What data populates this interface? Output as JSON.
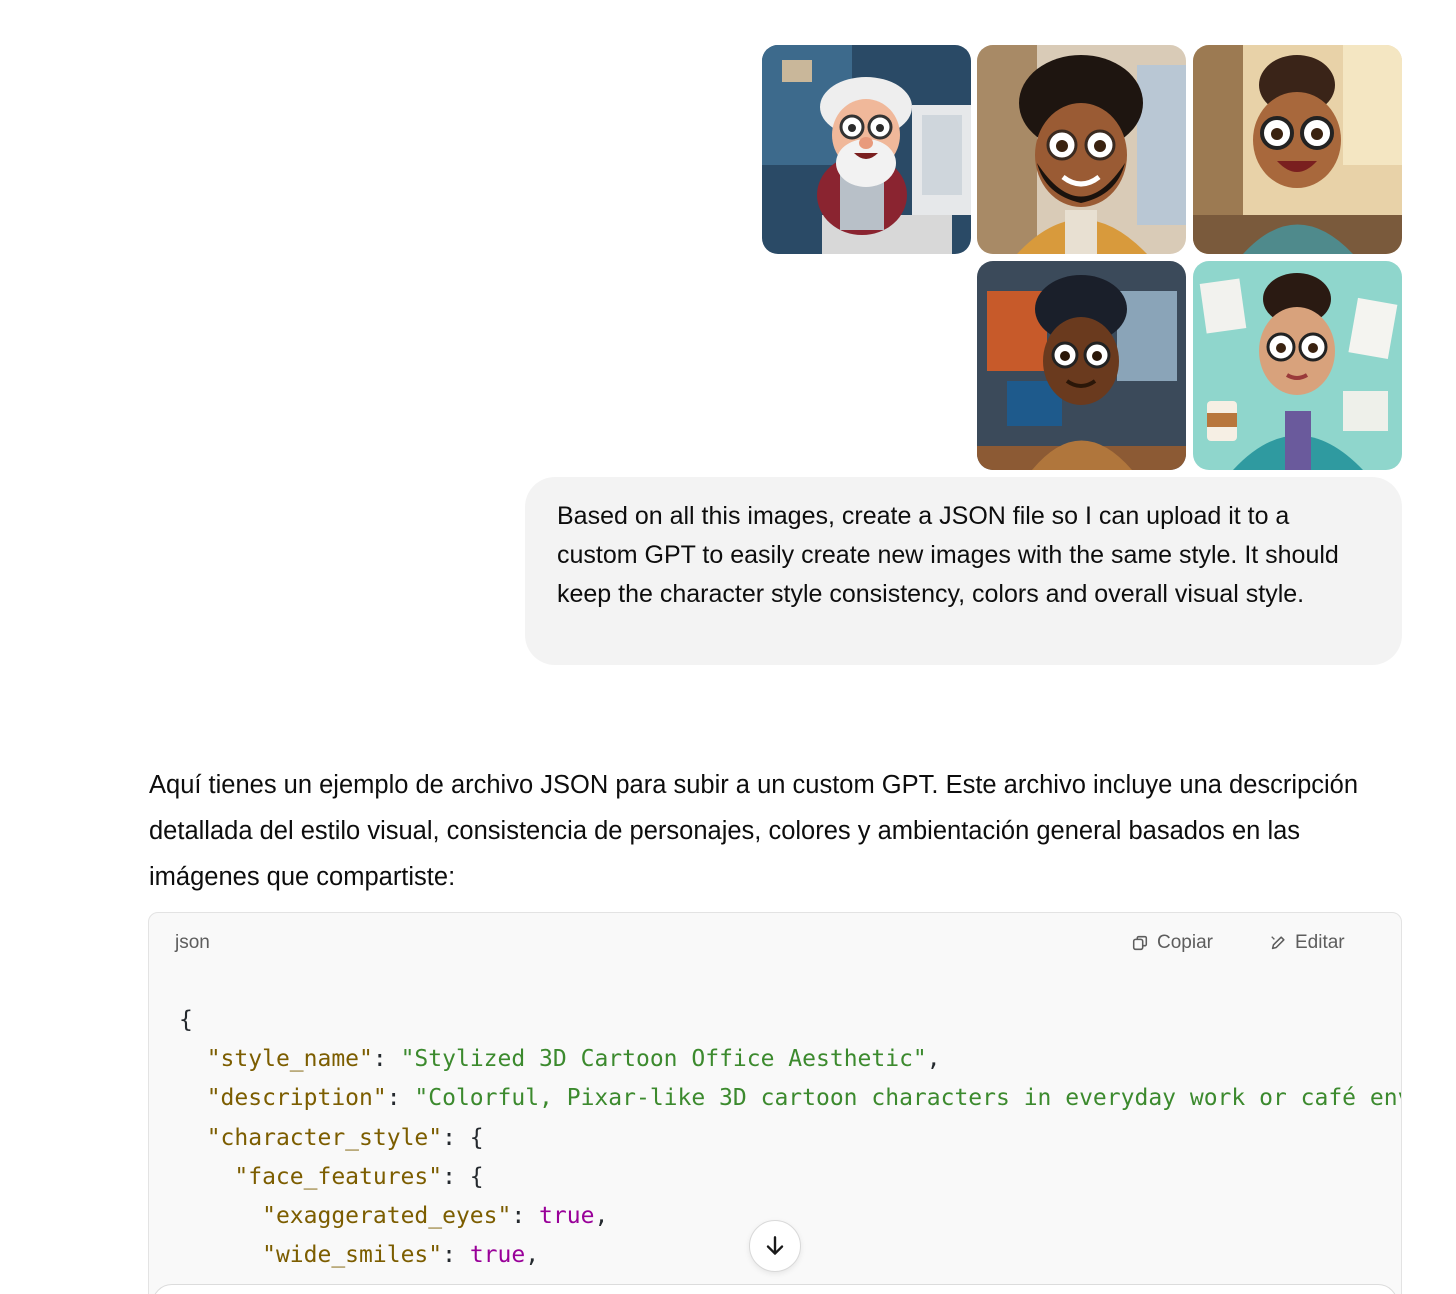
{
  "attachments": [
    {
      "name": "elderly-man-at-computer",
      "alt": "old man character"
    },
    {
      "name": "bearded-man-curly-hair",
      "alt": "bearded man character"
    },
    {
      "name": "woman-in-cafe",
      "alt": "woman character"
    },
    {
      "name": "young-man-at-desk",
      "alt": "young man character"
    },
    {
      "name": "woman-with-coffee",
      "alt": "woman with coffee character"
    }
  ],
  "user_message": "Based on all this images, create a JSON file so I can upload it to a custom GPT to easily create new images with the same style. It should keep the character style consistency, colors and overall visual style.",
  "assistant_message": "Aquí tienes un ejemplo de archivo JSON para subir a un custom GPT. Este archivo incluye una descripción detallada del estilo visual, consistencia de personajes, colores y ambientación general basados en las imágenes que compartiste:",
  "code_block": {
    "language": "json",
    "copy_label": "Copiar",
    "edit_label": "Editar",
    "lines": {
      "l1": "{",
      "l2_key": "\"style_name\"",
      "l2_val": "\"Stylized 3D Cartoon Office Aesthetic\"",
      "l3_key": "\"description\"",
      "l3_val": "\"Colorful, Pixar-like 3D cartoon characters in everyday work or café env",
      "l4_key": "\"character_style\"",
      "l5_key": "\"face_features\"",
      "l6_key": "\"exaggerated_eyes\"",
      "l6_val": "true",
      "l7_key": "\"wide_smiles\"",
      "l7_val": "true"
    }
  },
  "colors": {
    "bubble_bg": "#f3f3f3",
    "code_bg": "#f9f9f9",
    "json_key": "#7c5d00",
    "json_string": "#3c8a2e",
    "json_boolean": "#990099"
  },
  "icons": {
    "copy": "copy-icon",
    "edit": "pencil-icon",
    "scroll": "arrow-down-icon"
  }
}
